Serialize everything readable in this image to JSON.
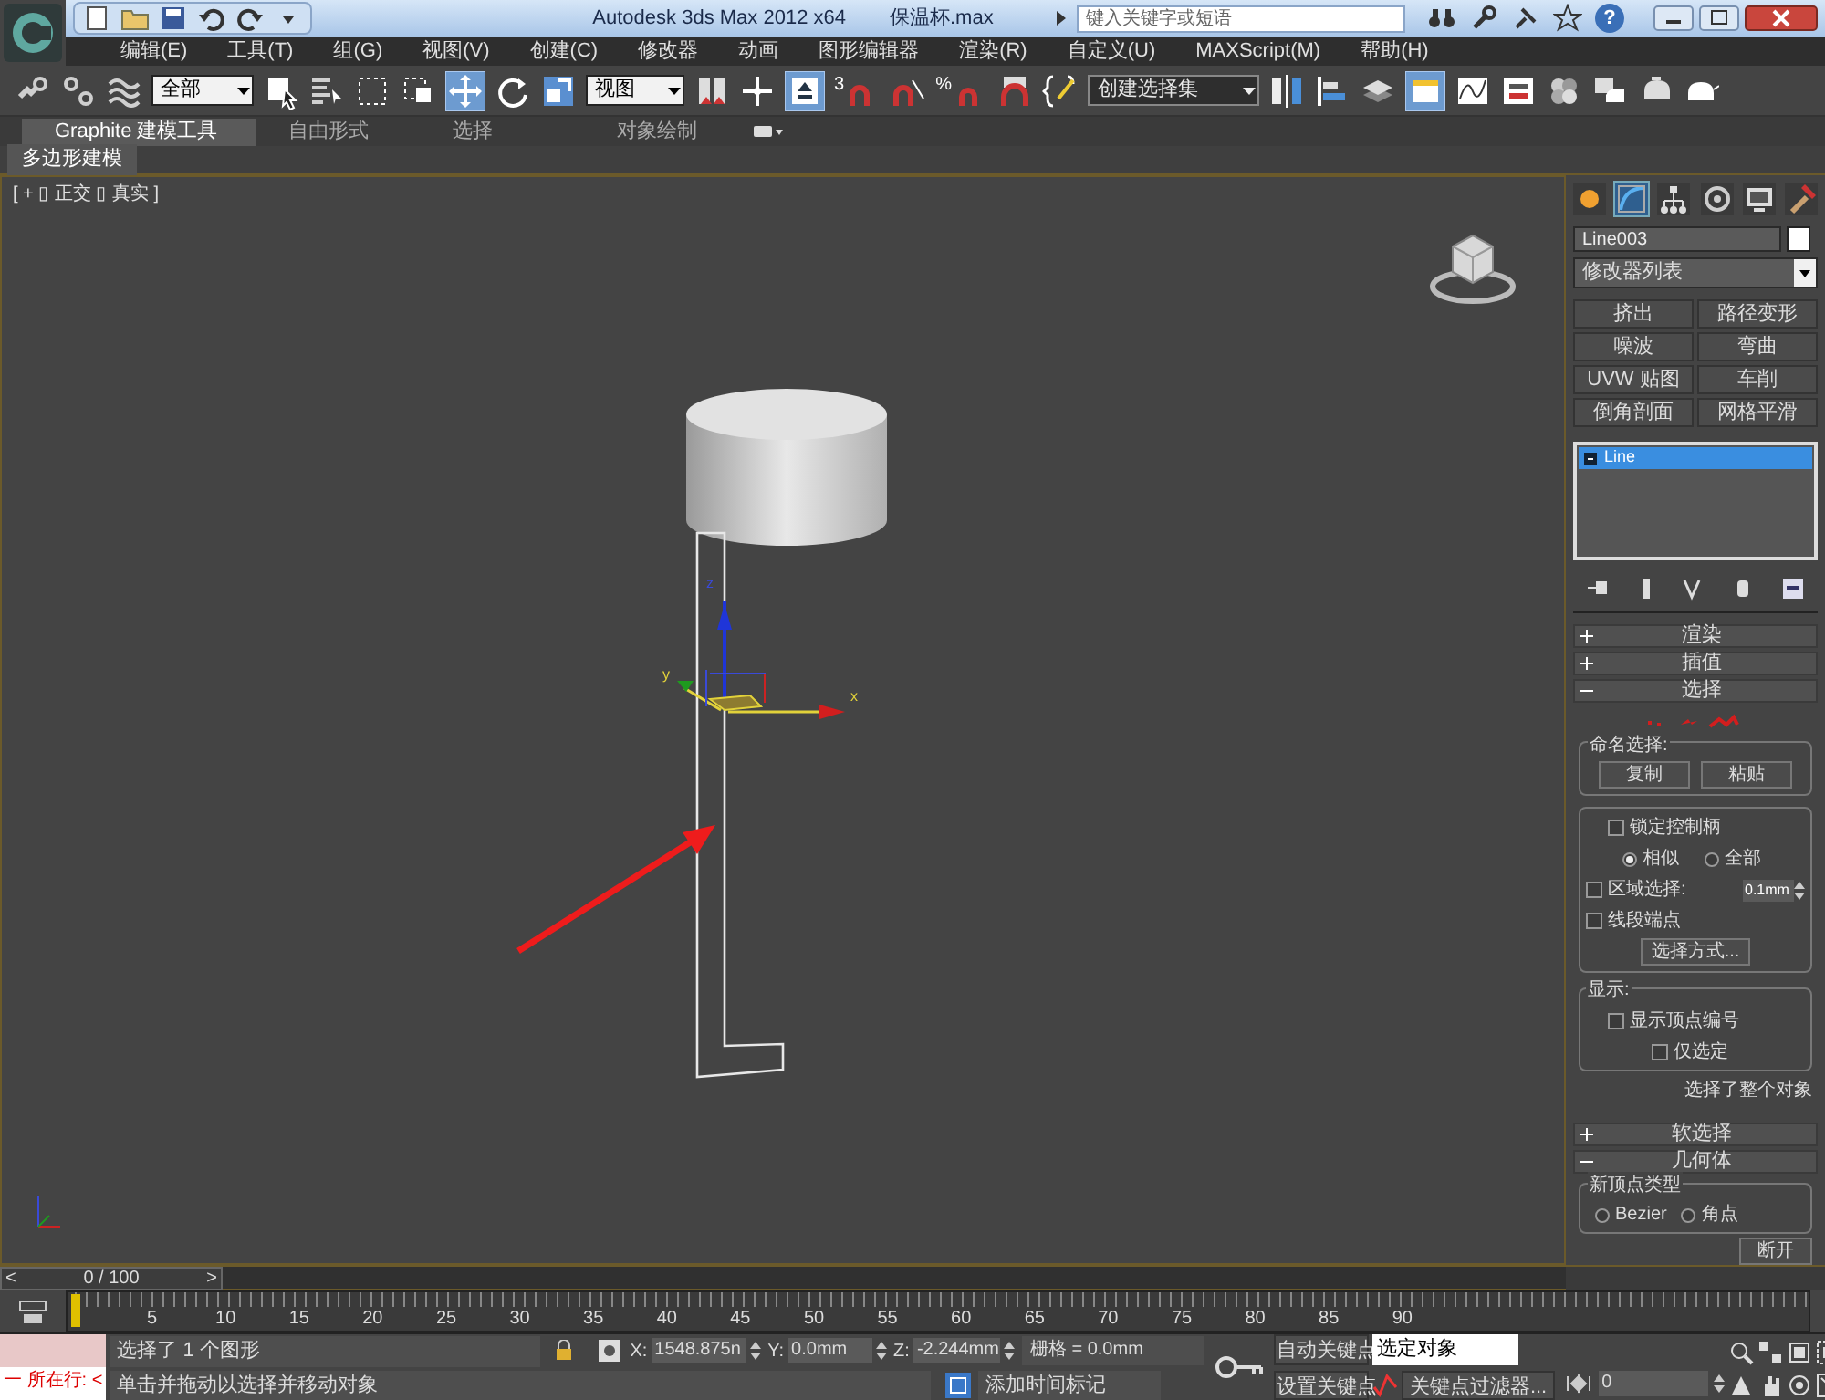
{
  "title_bar": {
    "title": "Autodesk 3ds Max  2012 x64",
    "file": "保温杯.max",
    "search_placeholder": "键入关键字或短语",
    "help": "?"
  },
  "menu": [
    "编辑(E)",
    "工具(T)",
    "组(G)",
    "视图(V)",
    "创建(C)",
    "修改器",
    "动画",
    "图形编辑器",
    "渲染(R)",
    "自定义(U)",
    "MAXScript(M)",
    "帮助(H)"
  ],
  "toolbar": {
    "selection_filter": "全部",
    "coord_system": "视图",
    "named_selection": "创建选择集",
    "snap_label": "3",
    "percent_label": "%"
  },
  "ribbon": {
    "tabs": [
      {
        "label": "Graphite 建模工具",
        "selected": true
      },
      {
        "label": "自由形式",
        "selected": false
      },
      {
        "label": "选择",
        "selected": false
      },
      {
        "label": "对象绘制",
        "selected": false
      }
    ],
    "panel": "多边形建模"
  },
  "viewport": {
    "label": "[ + ▯ 正交 ▯ 真实 ]",
    "gizmo_axes": [
      "x",
      "y",
      "z"
    ]
  },
  "command_panel": {
    "tabs": [
      {
        "selected": false
      },
      {
        "selected": true
      },
      {
        "selected": false
      },
      {
        "selected": false
      },
      {
        "selected": false
      },
      {
        "selected": false
      }
    ],
    "object_name": "Line003",
    "modifier_list": "修改器列表",
    "modifier_buttons": [
      "挤出",
      "路径变形",
      "噪波",
      "弯曲",
      "UVW 贴图",
      "车削",
      "倒角剖面",
      "网格平滑"
    ],
    "stack": [
      {
        "label": "Line",
        "selected": true
      }
    ],
    "rollouts_top": [
      {
        "title": "渲染",
        "expanded": false
      },
      {
        "title": "插值",
        "expanded": false
      },
      {
        "title": "选择",
        "expanded": true
      }
    ],
    "selection": {
      "named_group": "命名选择:",
      "copy": "复制",
      "paste": "粘贴",
      "lock_handles": {
        "label": "锁定控制柄",
        "checked": false
      },
      "handle_mode": [
        {
          "label": "相似",
          "selected": true
        },
        {
          "label": "全部",
          "selected": false
        }
      ],
      "area_select": {
        "label": "区域选择:",
        "checked": false,
        "value": "0.1mm"
      },
      "segment_end": {
        "label": "线段端点",
        "checked": false
      },
      "select_by": "选择方式...",
      "display_group": "显示:",
      "show_vertex_numbers": {
        "label": "显示顶点编号",
        "checked": false
      },
      "selected_only": {
        "label": "仅选定",
        "checked": false
      },
      "status": "选择了整个对象"
    },
    "rollouts_bottom": [
      {
        "title": "软选择",
        "expanded": false
      },
      {
        "title": "几何体",
        "expanded": true
      }
    ],
    "geometry": {
      "vertex_type_group": "新顶点类型",
      "vertex_types": [
        {
          "label": "Bezier",
          "selected": false
        },
        {
          "label": "角点",
          "selected": false
        }
      ],
      "break": "断开"
    }
  },
  "time_slider": {
    "frame": "0 / 100",
    "prev": "<",
    "next": ">",
    "level": 0
  },
  "track_bar": {
    "ticks": [
      "5",
      "10",
      "15",
      "20",
      "25",
      "30",
      "35",
      "40",
      "45",
      "50",
      "55",
      "60",
      "65",
      "70",
      "75",
      "80",
      "85",
      "90"
    ]
  },
  "status_bar": {
    "listener": "一  所在行:  <",
    "prompt": "选择了 1 个图形",
    "hint": "单击并拖动以选择并移动对象",
    "coords": [
      {
        "label": "X:",
        "value": "1548.875n"
      },
      {
        "label": "Y:",
        "value": "0.0mm"
      },
      {
        "label": "Z:",
        "value": "-2.244mm"
      }
    ],
    "grid": "栅格 = 0.0mm",
    "add_time_tag": "添加时间标记",
    "auto_key": "自动关键点",
    "set_key": "设置关键点",
    "key_mode": "选定对象",
    "key_filters": "关键点过滤器...",
    "frame": "0"
  }
}
